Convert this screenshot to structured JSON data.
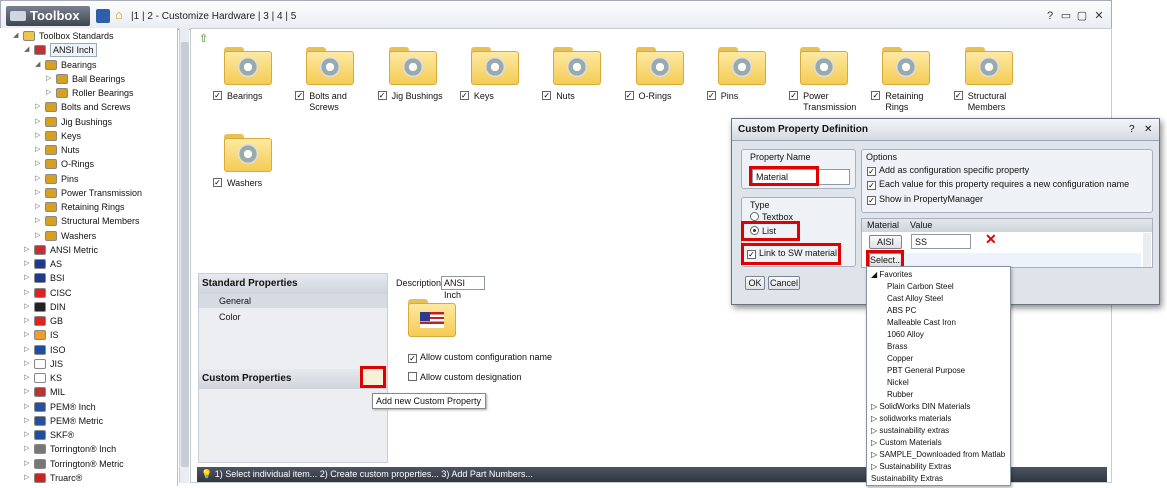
{
  "titlebar": {
    "app_title": "Toolbox",
    "breadcrumb": "|1 | 2 - Customize Hardware | 3 | 4 | 5"
  },
  "tree": [
    {
      "label": "Toolbox Standards",
      "icon": "folder-icon",
      "indent": 0,
      "arrow": "◢"
    },
    {
      "label": "ANSI Inch",
      "icon": "flag-us-icon",
      "indent": 1,
      "arrow": "◢",
      "selected": true
    },
    {
      "label": "Bearings",
      "icon": "gear-icon",
      "indent": 2,
      "arrow": "◢"
    },
    {
      "label": "Ball Bearings",
      "icon": "gear-icon",
      "indent": 3,
      "arrow": "▷"
    },
    {
      "label": "Roller Bearings",
      "icon": "gear-icon",
      "indent": 3,
      "arrow": "▷"
    },
    {
      "label": "Bolts and Screws",
      "icon": "bolt-icon",
      "indent": 2,
      "arrow": "▷"
    },
    {
      "label": "Jig Bushings",
      "icon": "bushing-icon",
      "indent": 2,
      "arrow": "▷"
    },
    {
      "label": "Keys",
      "icon": "key-icon",
      "indent": 2,
      "arrow": "▷"
    },
    {
      "label": "Nuts",
      "icon": "nut-icon",
      "indent": 2,
      "arrow": "▷"
    },
    {
      "label": "O-Rings",
      "icon": "oring-icon",
      "indent": 2,
      "arrow": "▷"
    },
    {
      "label": "Pins",
      "icon": "pin-icon",
      "indent": 2,
      "arrow": "▷"
    },
    {
      "label": "Power Transmission",
      "icon": "gear-icon",
      "indent": 2,
      "arrow": "▷"
    },
    {
      "label": "Retaining Rings",
      "icon": "ring-icon",
      "indent": 2,
      "arrow": "▷"
    },
    {
      "label": "Structural Members",
      "icon": "beam-icon",
      "indent": 2,
      "arrow": "▷"
    },
    {
      "label": "Washers",
      "icon": "washer-icon",
      "indent": 2,
      "arrow": "▷"
    },
    {
      "label": "ANSI Metric",
      "icon": "flag-us-icon",
      "indent": 1,
      "arrow": "▷"
    },
    {
      "label": "AS",
      "icon": "flag-au-icon",
      "indent": 1,
      "arrow": "▷"
    },
    {
      "label": "BSI",
      "icon": "flag-uk-icon",
      "indent": 1,
      "arrow": "▷"
    },
    {
      "label": "CISC",
      "icon": "flag-ca-icon",
      "indent": 1,
      "arrow": "▷"
    },
    {
      "label": "DIN",
      "icon": "flag-de-icon",
      "indent": 1,
      "arrow": "▷"
    },
    {
      "label": "GB",
      "icon": "flag-cn-icon",
      "indent": 1,
      "arrow": "▷"
    },
    {
      "label": "IS",
      "icon": "flag-in-icon",
      "indent": 1,
      "arrow": "▷"
    },
    {
      "label": "ISO",
      "icon": "iso-icon",
      "indent": 1,
      "arrow": "▷"
    },
    {
      "label": "JIS",
      "icon": "flag-jp-icon",
      "indent": 1,
      "arrow": "▷"
    },
    {
      "label": "KS",
      "icon": "flag-kr-icon",
      "indent": 1,
      "arrow": "▷"
    },
    {
      "label": "MIL",
      "icon": "flag-us-icon",
      "indent": 1,
      "arrow": "▷"
    },
    {
      "label": "PEM® Inch",
      "icon": "pem-icon",
      "indent": 1,
      "arrow": "▷"
    },
    {
      "label": "PEM® Metric",
      "icon": "pem-icon",
      "indent": 1,
      "arrow": "▷"
    },
    {
      "label": "SKF®",
      "icon": "skf-icon",
      "indent": 1,
      "arrow": "▷"
    },
    {
      "label": "Torrington® Inch",
      "icon": "torrington-icon",
      "indent": 1,
      "arrow": "▷"
    },
    {
      "label": "Torrington® Metric",
      "icon": "torrington-icon",
      "indent": 1,
      "arrow": "▷"
    },
    {
      "label": "Truarc®",
      "icon": "truarc-icon",
      "indent": 1,
      "arrow": "▷"
    }
  ],
  "categories": [
    {
      "label": "Bearings",
      "icon": "bearing-icon"
    },
    {
      "label": "Bolts and Screws",
      "icon": "bolt-icon"
    },
    {
      "label": "Jig Bushings",
      "icon": "bushing-icon"
    },
    {
      "label": "Keys",
      "icon": "key-icon"
    },
    {
      "label": "Nuts",
      "icon": "nut-icon"
    },
    {
      "label": "O-Rings",
      "icon": "oring-icon"
    },
    {
      "label": "Pins",
      "icon": "pin-icon"
    },
    {
      "label": "Power Transmission",
      "icon": "gear-icon"
    },
    {
      "label": "Retaining Rings",
      "icon": "ring-icon"
    },
    {
      "label": "Structural Members",
      "icon": "beam-icon"
    },
    {
      "label": "Washers",
      "icon": "washer-icon"
    }
  ],
  "properties": {
    "standard_header": "Standard Properties",
    "general": "General",
    "color": "Color",
    "custom_header": "Custom Properties",
    "description_label": "Description",
    "description_value": "ANSI Inch",
    "allow_config": "Allow custom configuration name",
    "allow_designation": "Allow custom designation",
    "tooltip": "Add new Custom Property"
  },
  "status": "1) Select individual item... 2) Create custom properties... 3) Add Part Numbers...",
  "dialog": {
    "title": "Custom Property Definition",
    "property_name_label": "Property Name",
    "property_name_value": "Material",
    "options_label": "Options",
    "opt1": "Add as configuration specific property",
    "opt2": "Each value for this property requires a new configuration name",
    "opt3": "Show in PropertyManager",
    "type_label": "Type",
    "textbox": "Textbox",
    "list": "List",
    "link_sw": "Link to SW material",
    "col_material": "Material",
    "col_value": "Value",
    "row1_material": "AISI Typ",
    "row1_value": "SS",
    "select_btn": "Select...",
    "ok": "OK",
    "cancel": "Cancel"
  },
  "material_list": [
    {
      "label": "Favorites",
      "indent": 0,
      "arrow": "◢"
    },
    {
      "label": "Plain Carbon Steel",
      "indent": 2,
      "arrow": ""
    },
    {
      "label": "Cast Alloy Steel",
      "indent": 2,
      "arrow": ""
    },
    {
      "label": "ABS PC",
      "indent": 2,
      "arrow": ""
    },
    {
      "label": "Malleable Cast Iron",
      "indent": 2,
      "arrow": ""
    },
    {
      "label": "1060 Alloy",
      "indent": 2,
      "arrow": ""
    },
    {
      "label": "Brass",
      "indent": 2,
      "arrow": ""
    },
    {
      "label": "Copper",
      "indent": 2,
      "arrow": ""
    },
    {
      "label": "PBT General Purpose",
      "indent": 2,
      "arrow": ""
    },
    {
      "label": "Nickel",
      "indent": 2,
      "arrow": ""
    },
    {
      "label": "Rubber",
      "indent": 2,
      "arrow": ""
    },
    {
      "label": "SolidWorks DIN Materials",
      "indent": 0,
      "arrow": "▷"
    },
    {
      "label": "solidworks materials",
      "indent": 0,
      "arrow": "▷"
    },
    {
      "label": "sustainability extras",
      "indent": 0,
      "arrow": "▷"
    },
    {
      "label": "Custom Materials",
      "indent": 0,
      "arrow": "▷"
    },
    {
      "label": "SAMPLE_Downloaded from Matlab",
      "indent": 0,
      "arrow": "▷"
    },
    {
      "label": "Sustainability Extras",
      "indent": 0,
      "arrow": "▷"
    },
    {
      "label": "Sustainability Extras",
      "indent": 0,
      "arrow": ""
    }
  ],
  "colors": {
    "highlight": "#e00000",
    "folder": "#f4cc55",
    "status_bg": "#2f3640"
  }
}
